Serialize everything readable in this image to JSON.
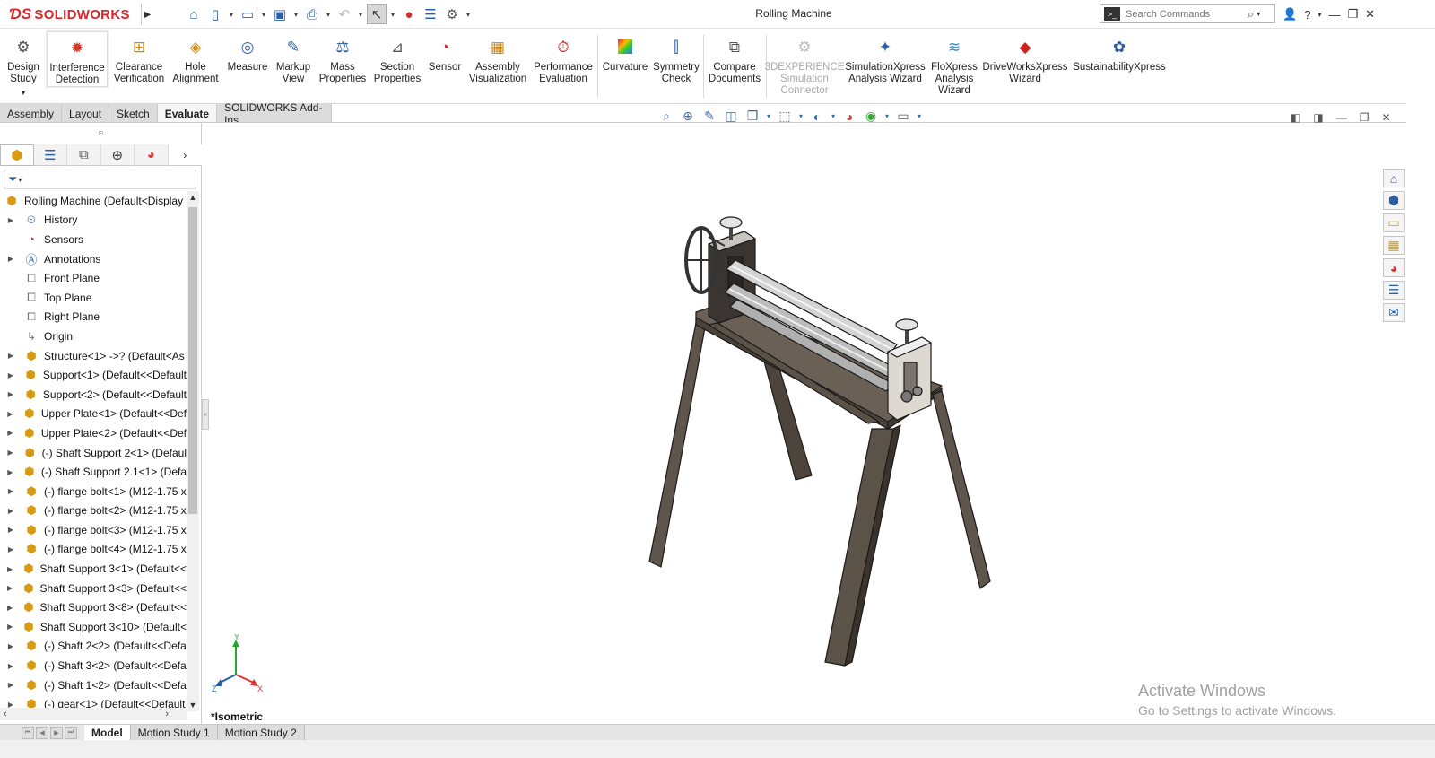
{
  "app": {
    "logo": "SOLIDWORKS",
    "document_title": "Rolling Machine"
  },
  "search": {
    "placeholder": "Search Commands"
  },
  "commands": [
    {
      "label": "Design\nStudy",
      "icon": "design-study-icon"
    },
    {
      "label": "Interference\nDetection",
      "icon": "interference-detection-icon",
      "active": true
    },
    {
      "label": "Clearance\nVerification",
      "icon": "clearance-verification-icon"
    },
    {
      "label": "Hole\nAlignment",
      "icon": "hole-alignment-icon"
    },
    {
      "label": "Measure",
      "icon": "measure-icon"
    },
    {
      "label": "Markup\nView",
      "icon": "markup-view-icon"
    },
    {
      "label": "Mass\nProperties",
      "icon": "mass-properties-icon"
    },
    {
      "label": "Section\nProperties",
      "icon": "section-properties-icon"
    },
    {
      "label": "Sensor",
      "icon": "sensor-icon"
    },
    {
      "label": "Assembly\nVisualization",
      "icon": "assembly-visualization-icon"
    },
    {
      "label": "Performance\nEvaluation",
      "icon": "performance-evaluation-icon"
    },
    {
      "label": "Curvature",
      "icon": "curvature-icon"
    },
    {
      "label": "Symmetry\nCheck",
      "icon": "symmetry-check-icon"
    },
    {
      "label": "Compare\nDocuments",
      "icon": "compare-documents-icon"
    },
    {
      "label": "3DEXPERIENCE\nSimulation\nConnector",
      "icon": "3dexperience-icon",
      "disabled": true
    },
    {
      "label": "SimulationXpress\nAnalysis Wizard",
      "icon": "simulationxpress-icon"
    },
    {
      "label": "FloXpress\nAnalysis\nWizard",
      "icon": "floxpress-icon"
    },
    {
      "label": "DriveWorksXpress\nWizard",
      "icon": "driveworksxpress-icon"
    },
    {
      "label": "SustainabilityXpress",
      "icon": "sustainabilityxpress-icon"
    }
  ],
  "tabs": [
    {
      "label": "Assembly"
    },
    {
      "label": "Layout"
    },
    {
      "label": "Sketch"
    },
    {
      "label": "Evaluate",
      "active": true
    },
    {
      "label": "SOLIDWORKS Add-Ins"
    }
  ],
  "tree": {
    "root": "Rolling Machine  (Default<Display",
    "items": [
      {
        "label": "History",
        "icon": "history-icon",
        "expandable": true
      },
      {
        "label": "Sensors",
        "icon": "sensor-icon",
        "expandable": false
      },
      {
        "label": "Annotations",
        "icon": "annotations-icon",
        "expandable": true
      },
      {
        "label": "Front Plane",
        "icon": "plane-icon",
        "expandable": false
      },
      {
        "label": "Top Plane",
        "icon": "plane-icon",
        "expandable": false
      },
      {
        "label": "Right Plane",
        "icon": "plane-icon",
        "expandable": false
      },
      {
        "label": "Origin",
        "icon": "origin-icon",
        "expandable": false
      },
      {
        "label": "Structure<1> ->? (Default<As",
        "icon": "part-icon",
        "expandable": true
      },
      {
        "label": "Support<1> (Default<<Default",
        "icon": "part-icon",
        "expandable": true
      },
      {
        "label": "Support<2> (Default<<Default",
        "icon": "part-icon",
        "expandable": true
      },
      {
        "label": "Upper Plate<1> (Default<<Def",
        "icon": "part-icon",
        "expandable": true
      },
      {
        "label": "Upper Plate<2> (Default<<Def",
        "icon": "part-icon",
        "expandable": true
      },
      {
        "label": "(-) Shaft Support 2<1> (Defaul",
        "icon": "part-icon",
        "expandable": true
      },
      {
        "label": "(-) Shaft Support 2.1<1> (Defa",
        "icon": "part-icon",
        "expandable": true
      },
      {
        "label": "(-) flange bolt<1> (M12-1.75 x",
        "icon": "part-icon",
        "expandable": true
      },
      {
        "label": "(-) flange bolt<2> (M12-1.75 x",
        "icon": "part-icon",
        "expandable": true
      },
      {
        "label": "(-) flange bolt<3> (M12-1.75 x",
        "icon": "part-icon",
        "expandable": true
      },
      {
        "label": "(-) flange bolt<4> (M12-1.75 x",
        "icon": "part-icon",
        "expandable": true
      },
      {
        "label": "Shaft Support 3<1> (Default<<",
        "icon": "part-icon",
        "expandable": true
      },
      {
        "label": "Shaft Support 3<3> (Default<<",
        "icon": "part-icon",
        "expandable": true
      },
      {
        "label": "Shaft Support 3<8> (Default<<",
        "icon": "part-icon",
        "expandable": true
      },
      {
        "label": "Shaft Support 3<10> (Default<",
        "icon": "part-icon",
        "expandable": true
      },
      {
        "label": "(-) Shaft 2<2> (Default<<Defa",
        "icon": "part-icon",
        "expandable": true
      },
      {
        "label": "(-) Shaft 3<2> (Default<<Defa",
        "icon": "part-icon",
        "expandable": true
      },
      {
        "label": "(-) Shaft 1<2> (Default<<Defa",
        "icon": "part-icon",
        "expandable": true
      },
      {
        "label": "(-) gear<1> (Default<<Default",
        "icon": "part-icon",
        "expandable": true
      }
    ]
  },
  "viewport": {
    "view_name": "*Isometric",
    "triad": {
      "x": "X",
      "y": "Y",
      "z": "Z"
    }
  },
  "watermark": {
    "line1": "Activate Windows",
    "line2": "Go to Settings to activate Windows."
  },
  "bottom_tabs": [
    {
      "label": "Model",
      "active": true
    },
    {
      "label": "Motion Study 1"
    },
    {
      "label": "Motion Study 2"
    }
  ],
  "colors": {
    "brand_red": "#d8262a",
    "frame_steel": "#5a5046",
    "roller": "#c8c8c8",
    "part_icon": "#d79a10"
  }
}
